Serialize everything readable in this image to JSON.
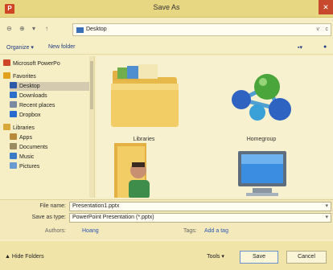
{
  "window": {
    "title": "Save As",
    "close_glyph": "✕"
  },
  "address": {
    "back_glyph": "⊖",
    "forward_glyph": "⊕",
    "dropdown_glyph": "▾",
    "up_glyph": "↑",
    "path": "Desktop",
    "chevron_glyph": "v",
    "refresh_glyph": "c"
  },
  "toolbar": {
    "organize": "Organize ▾",
    "new_folder": "New folder",
    "view_glyph": "▪▾",
    "help_glyph": "●"
  },
  "nav": {
    "items": [
      {
        "label": "Microsoft PowerPo",
        "icon": "powerpoint-icon",
        "color": "#d04525"
      },
      {
        "label": "Favorites",
        "icon": "star-icon",
        "color": "#e0a21c",
        "header": true
      },
      {
        "label": "Desktop",
        "icon": "desktop-icon",
        "color": "#2c5aa8",
        "selected": true
      },
      {
        "label": "Downloads",
        "icon": "downloads-icon",
        "color": "#2c6fc8"
      },
      {
        "label": "Recent places",
        "icon": "recent-icon",
        "color": "#7a8aa0"
      },
      {
        "label": "Dropbox",
        "icon": "dropbox-icon",
        "color": "#2a6ad0"
      },
      {
        "label": "Libraries",
        "icon": "libraries-icon",
        "color": "#d9a83a",
        "header": true
      },
      {
        "label": "Apps",
        "icon": "apps-icon",
        "color": "#b88b3a"
      },
      {
        "label": "Documents",
        "icon": "documents-icon",
        "color": "#9a8c60"
      },
      {
        "label": "Music",
        "icon": "music-icon",
        "color": "#3a7bc8"
      },
      {
        "label": "Pictures",
        "icon": "pictures-icon",
        "color": "#6a9bd0"
      }
    ]
  },
  "content": {
    "tiles": [
      {
        "label": "Libraries"
      },
      {
        "label": "Homegroup"
      },
      {
        "label": ""
      },
      {
        "label": ""
      }
    ]
  },
  "form": {
    "file_name_label": "File name:",
    "file_name_value": "Presentation1.pptx",
    "save_type_label": "Save as type:",
    "save_type_value": "PowerPoint Presentation (*.pptx)",
    "authors_label": "Authors:",
    "authors_value": "Hoang",
    "tags_label": "Tags:",
    "tags_value": "Add a tag",
    "dropdown_glyph": "▾"
  },
  "bottom": {
    "hide_folders": "Hide Folders",
    "hide_glyph": "▲",
    "tools": "Tools ▾",
    "save": "Save",
    "cancel": "Cancel"
  },
  "colors": {
    "accent": "#2a56b4",
    "titlebar": "#e8d782",
    "close": "#c84a2e"
  }
}
